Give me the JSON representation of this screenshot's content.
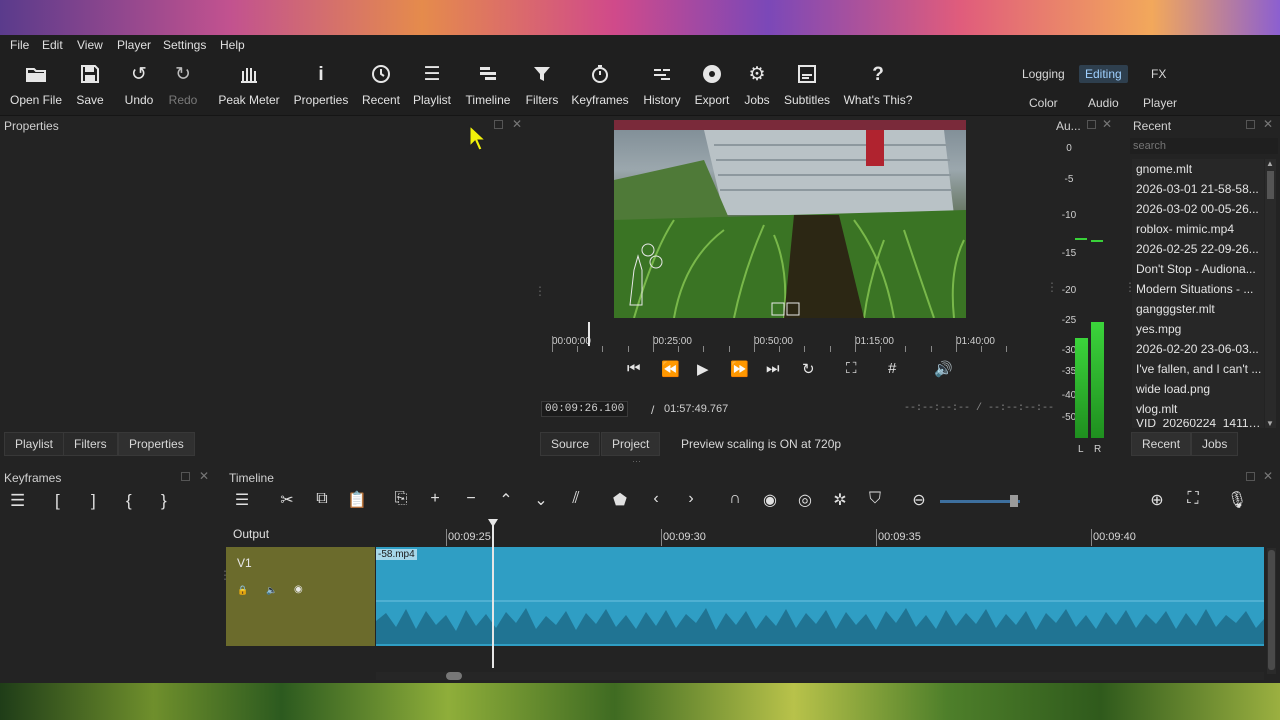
{
  "menu": [
    "File",
    "Edit",
    "View",
    "Player",
    "Settings",
    "Help"
  ],
  "toolbar": [
    {
      "label": "Open File",
      "icon": "folder-open-icon"
    },
    {
      "label": "Save",
      "icon": "save-icon"
    },
    {
      "label": "Undo",
      "icon": "undo-icon"
    },
    {
      "label": "Redo",
      "icon": "redo-icon"
    },
    {
      "label": "Peak Meter",
      "icon": "peak-meter-icon"
    },
    {
      "label": "Properties",
      "icon": "info-icon"
    },
    {
      "label": "Recent",
      "icon": "clock-icon"
    },
    {
      "label": "Playlist",
      "icon": "list-icon"
    },
    {
      "label": "Timeline",
      "icon": "timeline-icon"
    },
    {
      "label": "Filters",
      "icon": "funnel-icon"
    },
    {
      "label": "Keyframes",
      "icon": "stopwatch-icon"
    },
    {
      "label": "History",
      "icon": "history-icon"
    },
    {
      "label": "Export",
      "icon": "export-icon"
    },
    {
      "label": "Jobs",
      "icon": "gear-icon"
    },
    {
      "label": "Subtitles",
      "icon": "subtitles-icon"
    },
    {
      "label": "What's This?",
      "icon": "question-icon"
    }
  ],
  "layouts": {
    "row1": [
      "Logging",
      "Editing",
      "FX"
    ],
    "row2": [
      "Color",
      "Audio",
      "Player"
    ],
    "active": "Editing"
  },
  "properties_panel": {
    "title": "Properties",
    "tabs": [
      "Playlist",
      "Filters",
      "Properties"
    ],
    "active_tab": "Properties"
  },
  "player": {
    "ruler_labels": [
      "00:00:00",
      "00:25:00",
      "00:50:00",
      "01:15:00",
      "01:40:00"
    ],
    "position": "00:09:26.100",
    "separator": "/",
    "duration": "01:57:49.767",
    "in_out": "--:--:--:-- / --:--:--:--",
    "tabs": [
      "Source",
      "Project"
    ],
    "active_tab": "Project",
    "status": "Preview scaling is ON at 720p"
  },
  "audio_meter": {
    "title": "Au...",
    "scale": [
      "0",
      "-5",
      "-10",
      "-15",
      "-20",
      "-25",
      "-30",
      "-35",
      "-40",
      "-50"
    ],
    "channels": [
      "L",
      "R"
    ],
    "levels_db": {
      "L": -30,
      "R": -25
    }
  },
  "recent": {
    "title": "Recent",
    "search_placeholder": "search",
    "items": [
      "gnome.mlt",
      "2026-03-01 21-58-58...",
      "2026-03-02 00-05-26...",
      "roblox- mimic.mp4",
      "2026-02-25 22-09-26...",
      "Don't Stop - Audiona...",
      "Modern Situations - ...",
      "gangggster.mlt",
      "yes.mpg",
      "2026-02-20 23-06-03...",
      "I've fallen, and I can't ...",
      "wide load.png",
      "vlog.mlt",
      "VID_20260224_14110..."
    ],
    "tabs": [
      "Recent",
      "Jobs"
    ],
    "active_tab": "Recent"
  },
  "keyframes": {
    "title": "Keyframes"
  },
  "timeline": {
    "title": "Timeline",
    "output_label": "Output",
    "track_name": "V1",
    "clip_label": "-58.mp4",
    "ruler_labels": [
      "00:09:25",
      "00:09:30",
      "00:09:35",
      "00:09:40"
    ],
    "colors": {
      "clip": "#2f9ec4",
      "track_header": "#6b6b2c"
    }
  }
}
